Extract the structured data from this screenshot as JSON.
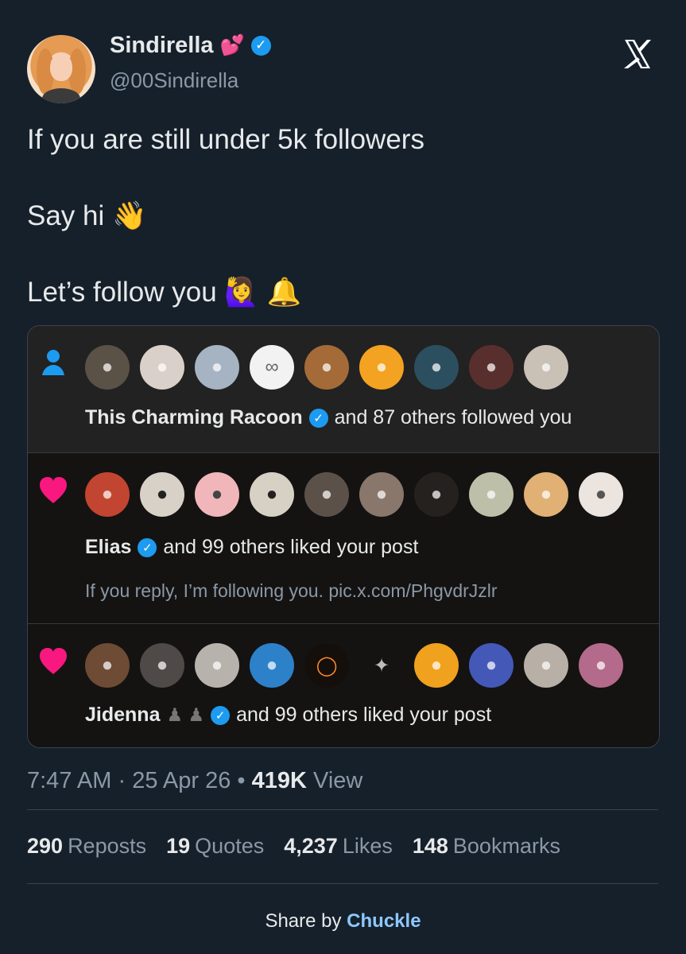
{
  "user": {
    "display_name": "Sindirella",
    "name_emoji": "💕",
    "verified": true,
    "handle": "@00Sindirella"
  },
  "tweet": {
    "lines": [
      "If you are still under 5k followers",
      "Say hi 👋",
      "Let’s follow you 🙋‍♀️ 🔔"
    ]
  },
  "media": {
    "notifications": [
      {
        "type": "follow",
        "icon": "person-icon",
        "avatars": [
          "racoon-avatar",
          "gray-hair-avatar",
          "wave-avatar",
          "infinity-avatar",
          "guy-avatar",
          "duck-avatar",
          "alien-avatar",
          "brand-avatar",
          "bald-guy-avatar"
        ],
        "name": "This Charming Racoon",
        "verified": true,
        "rest": "and 87 others followed you"
      },
      {
        "type": "like",
        "icon": "heart-icon",
        "avatars": [
          "jersey-avatar",
          "afro-avatar",
          "cat-avatar",
          "hood-avatar",
          "mime-avatar",
          "man-avatar",
          "dark-cat-avatar",
          "coin-avatar",
          "boy-avatar",
          "woman-avatar"
        ],
        "name": "Elias",
        "verified": true,
        "rest": "and 99 others liked your post",
        "subtext": "If you reply, I’m following you. pic.x.com/PhgvdrJzlr"
      },
      {
        "type": "like",
        "icon": "heart-icon",
        "avatars": [
          "cartoon-avatar",
          "portrait-avatar",
          "astronaut-avatar",
          "blue-avatar",
          "eclipse-avatar",
          "bird-avatar",
          "smile-avatar",
          "blue-light-avatar",
          "bald-man-avatar",
          "pink-avatar"
        ],
        "name": "Jidenna",
        "name_badges": "♟ ♟",
        "verified": true,
        "rest": "and 99 others liked your post"
      }
    ]
  },
  "meta": {
    "time": "7:47 AM",
    "dot1": "·",
    "date": "25 Apr 26",
    "dot2": "•",
    "views": "419K",
    "views_label": "View"
  },
  "stats": {
    "reposts_count": "290",
    "reposts_label": "Reposts",
    "quotes_count": "19",
    "quotes_label": "Quotes",
    "likes_count": "4,237",
    "likes_label": "Likes",
    "bookmarks_count": "148",
    "bookmarks_label": "Bookmarks"
  },
  "footer": {
    "prefix": "Share by",
    "brand": "Chuckle"
  },
  "colors": {
    "background": "#15202b",
    "accent": "#1d9bf0",
    "like": "#f91880",
    "muted": "#8b98a5"
  }
}
